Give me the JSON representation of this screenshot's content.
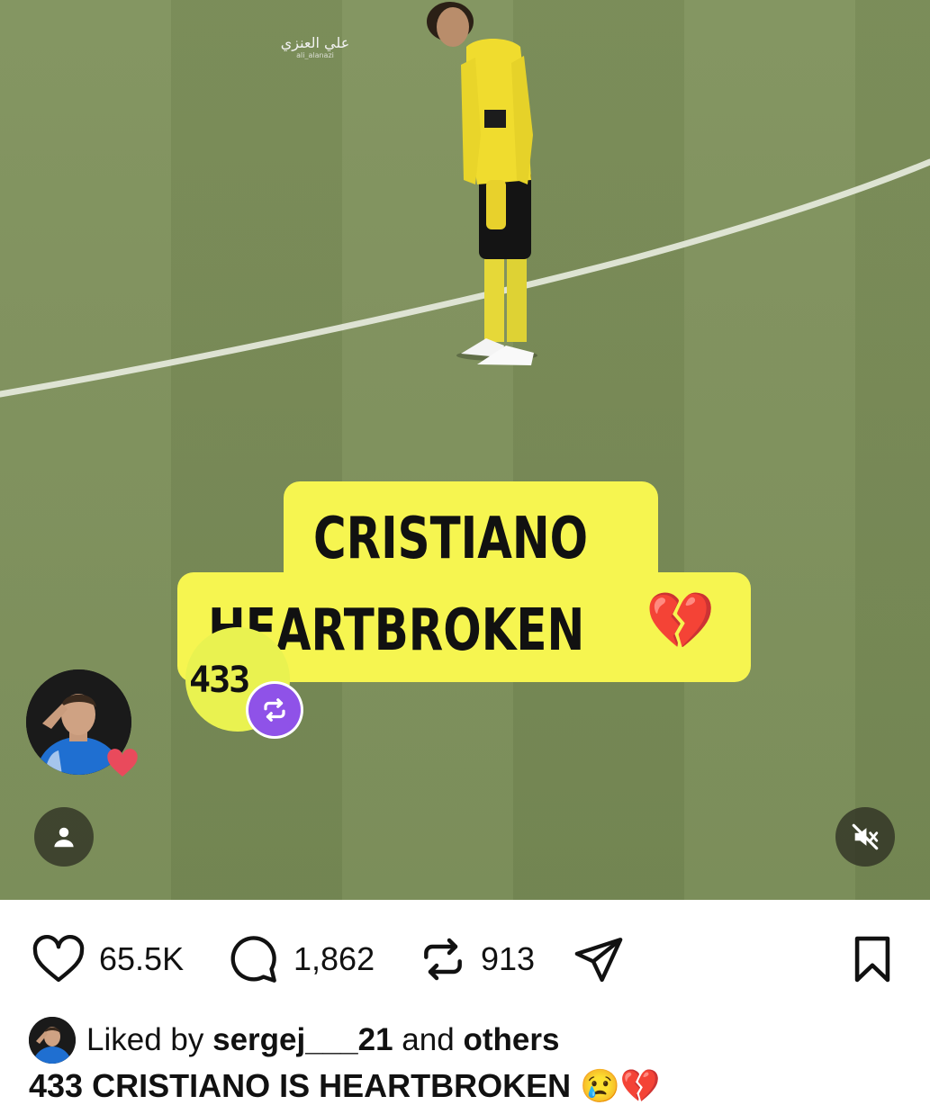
{
  "media": {
    "watermark_title": "علي العنزي",
    "watermark_sub": "ali_alanazi",
    "caption_line1": "CRISTIANO",
    "caption_line2": "HEARTBROKEN",
    "caption_emoji": "💔",
    "logo_text": "433"
  },
  "actions": {
    "likes": "65.5K",
    "comments": "1,862",
    "reposts": "913"
  },
  "liked_by": {
    "prefix": "Liked by",
    "user": "sergej___21",
    "middle": "and",
    "suffix": "others"
  },
  "post_caption": "433 CRISTIANO IS HEARTBROKEN 😢💔",
  "colors": {
    "caption_bg": "#f6f550",
    "repost_badge": "#8f52e8",
    "field": "#7d8f5a"
  }
}
